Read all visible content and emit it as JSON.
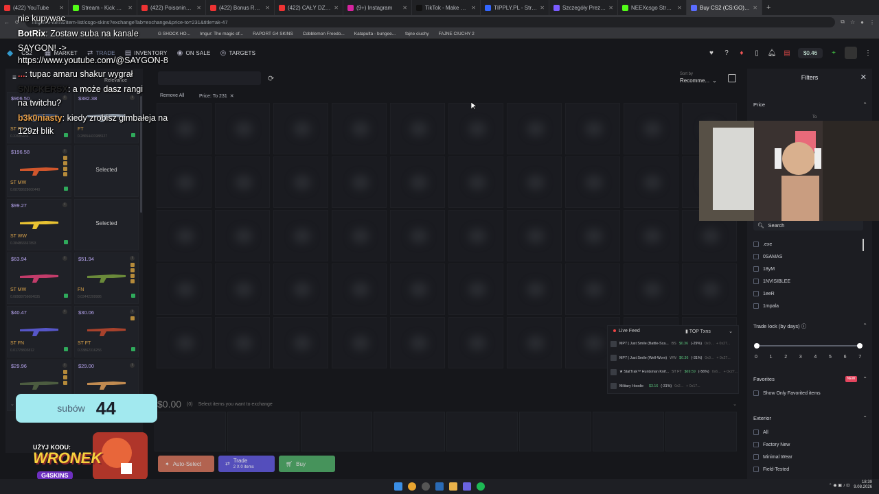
{
  "browser": {
    "tabs": [
      {
        "label": "(422) YouTube",
        "color": "#e33"
      },
      {
        "label": "Stream - Kick Dashboard",
        "color": "#53fc18"
      },
      {
        "label": "(422) Poisoning myself w",
        "color": "#e33"
      },
      {
        "label": "(422) Bonus RPK - GRUB",
        "color": "#e33"
      },
      {
        "label": "(422) CAŁY DZIEŃ NA OB",
        "color": "#e33"
      },
      {
        "label": "(9+) Instagram",
        "color": "#d6249f"
      },
      {
        "label": "TikTok - Make Your Day",
        "color": "#111"
      },
      {
        "label": "TIPPLY.PL - Streamuj, bat",
        "color": "#36f"
      },
      {
        "label": "Szczegóły Prezentu | G4S",
        "color": "#7b5cff"
      },
      {
        "label": "NEEXcsgo Stream - Watch",
        "color": "#53fc18"
      },
      {
        "label": "Buy CS2 (CS:GO) Skins | M",
        "color": "#5a6cff",
        "active": true
      }
    ],
    "url": "/ingame-items/item-list/csgo-skins?exchangeTab=exchange&price-to=231&title=ak-47",
    "bookmarks": [
      "G SHOCK HO...",
      "Imgur: The magic of...",
      "RAPORT G4 SKINS",
      "Cobblemon Freedo...",
      "Katapulta - bungee...",
      "fajne ciuchy",
      "FAJNE CIUCHY 2"
    ]
  },
  "header": {
    "game": "CS2",
    "nav": [
      {
        "label": "MARKET",
        "icon": "market-icon"
      },
      {
        "label": "TRADE",
        "icon": "trade-icon",
        "active": true
      },
      {
        "label": "INVENTORY",
        "icon": "inventory-icon"
      },
      {
        "label": "ON SALE",
        "icon": "on-sale-icon"
      },
      {
        "label": "TARGETS",
        "icon": "targets-icon"
      }
    ],
    "balance": "$0.46",
    "flag": "US"
  },
  "inventory": {
    "sort_label": "Relevance",
    "items": [
      {
        "price": "$906.50",
        "wear": "ST FT",
        "sub": "0.33985436..",
        "stickers": 0,
        "selected": false,
        "color": "#4a5b7a"
      },
      {
        "price": "$382.38",
        "wear": "FT",
        "sub": "0.28654431988127",
        "stickers": 0,
        "selected": false,
        "color": "#9aa6b4"
      },
      {
        "price": "$196.58",
        "wear": "ST MW",
        "sub": "0.08708628600440",
        "stickers": 4,
        "selected": false,
        "color": "#d0562c"
      },
      {
        "price": "",
        "wear": "",
        "sub": "",
        "stickers": 0,
        "selected": true,
        "color": ""
      },
      {
        "price": "$99.27",
        "wear": "ST WW",
        "sub": "0.384866667893",
        "stickers": 0,
        "selected": false,
        "color": "#e8c232"
      },
      {
        "price": "",
        "wear": "",
        "sub": "",
        "stickers": 0,
        "selected": true,
        "color": ""
      },
      {
        "price": "$63.94",
        "wear": "ST MW",
        "sub": "0.08908756684035",
        "stickers": 0,
        "selected": false,
        "color": "#c23c6a"
      },
      {
        "price": "$51.94",
        "wear": "FN",
        "sub": "0.03442209986",
        "stickers": 4,
        "selected": false,
        "color": "#6a8a3a"
      },
      {
        "price": "$40.47",
        "wear": "ST FN",
        "sub": "0.01778803812",
        "stickers": 0,
        "selected": false,
        "color": "#5656c8"
      },
      {
        "price": "$30.06",
        "wear": "ST FT",
        "sub": "0.33862316256",
        "stickers": 1,
        "selected": false,
        "color": "#a8422c"
      },
      {
        "price": "$29.96",
        "wear": "",
        "sub": "",
        "stickers": 3,
        "selected": false,
        "color": "#4c5c40"
      },
      {
        "price": "$29.00",
        "wear": "",
        "sub": "",
        "stickers": 0,
        "selected": false,
        "color": "#c08a50"
      }
    ],
    "selected_text": "Selected"
  },
  "market": {
    "chips": [
      "Remove All",
      "Price: To 231"
    ],
    "sort_small": "Sort by",
    "sort_value": "Recomme...",
    "total": "$0.00",
    "count": "(0)",
    "hint": "Select items you want to exchange"
  },
  "live_feed": {
    "title": "Live Feed",
    "tab2": "TOP Txns",
    "rows": [
      {
        "name": "MP7 | Just Smile (Battle-Sca...",
        "wear": "BS",
        "price": "$0.36",
        "pct": "(-29%)",
        "time": "0x0...",
        "extra": "+ 0x27..."
      },
      {
        "name": "MP7 | Just Smile (Well-Worn)",
        "wear": "WW",
        "price": "$0.36",
        "pct": "(-31%)",
        "time": "0x0...",
        "extra": "+ 0x27..."
      },
      {
        "name": "★ StatTrak™ Huntsman Knif...",
        "wear": "ST FT",
        "price": "$69.59",
        "pct": "(-56%)",
        "time": "0x6...",
        "extra": "+ 0x27..."
      },
      {
        "name": "Military Hoodie",
        "wear": "",
        "price": "$3.16",
        "pct": "(-31%)",
        "time": "0x2...",
        "extra": "+ 0x17..."
      }
    ]
  },
  "actions": {
    "auto": "Auto-Select",
    "trade": "Trade",
    "trade_sub": "2 X 0 items",
    "buy": "Buy"
  },
  "filters": {
    "title": "Filters",
    "price": "Price",
    "price_to": "To",
    "search_placeholder": "Search",
    "players": [
      ".exe",
      "0SAMAS",
      "18yM",
      "1NVISIBLEE",
      "1eeR",
      "1mpala"
    ],
    "trade_lock": "Trade lock (by days)",
    "trade_lock_ticks": [
      "0",
      "1",
      "2",
      "3",
      "4",
      "5",
      "6",
      "7"
    ],
    "trade_lock_range": [
      0,
      7
    ],
    "favorites": "Favorites",
    "new_badge": "NEW",
    "show_fav": "Show Only Favorited items",
    "exterior": "Exterior",
    "exterior_opts": [
      "All",
      "Factory New",
      "Minimal Wear",
      "Field-Tested"
    ]
  },
  "stream": {
    "chat": [
      {
        "name": "",
        "text": "nie kupywac",
        "color": "#fff"
      },
      {
        "name": "BotRix",
        "text": ": Zostaw suba na kanale",
        "color": "#fff"
      },
      {
        "name": "",
        "text": "SAYGON! ->",
        "color": "#fff"
      },
      {
        "name": "",
        "text": "https://www.youtube.com/@SAYGON-8",
        "color": "#fff"
      },
      {
        "name": "...",
        "text": ": tupac amaru shakur wygrał",
        "color": "#e44"
      },
      {
        "name": "SNICKERSX",
        "text": ": a może dasz rangi",
        "color": "#222"
      },
      {
        "name": "",
        "text": "na twitchu?",
        "color": "#fff"
      },
      {
        "name": "b3k0niasty",
        "text": ": kiedy zrobisz gimbałeja na",
        "color": "#e8a04a"
      },
      {
        "name": "",
        "text": "129zł blik",
        "color": "#fff"
      }
    ],
    "sub_label": "subów",
    "sub_count": "44",
    "promo_top": "UŻYJ KODU:",
    "promo_main": "WRONEK",
    "promo_brand": "G4SKINS"
  },
  "taskbar": {
    "time": "18:39",
    "date": "9.08.2026"
  }
}
